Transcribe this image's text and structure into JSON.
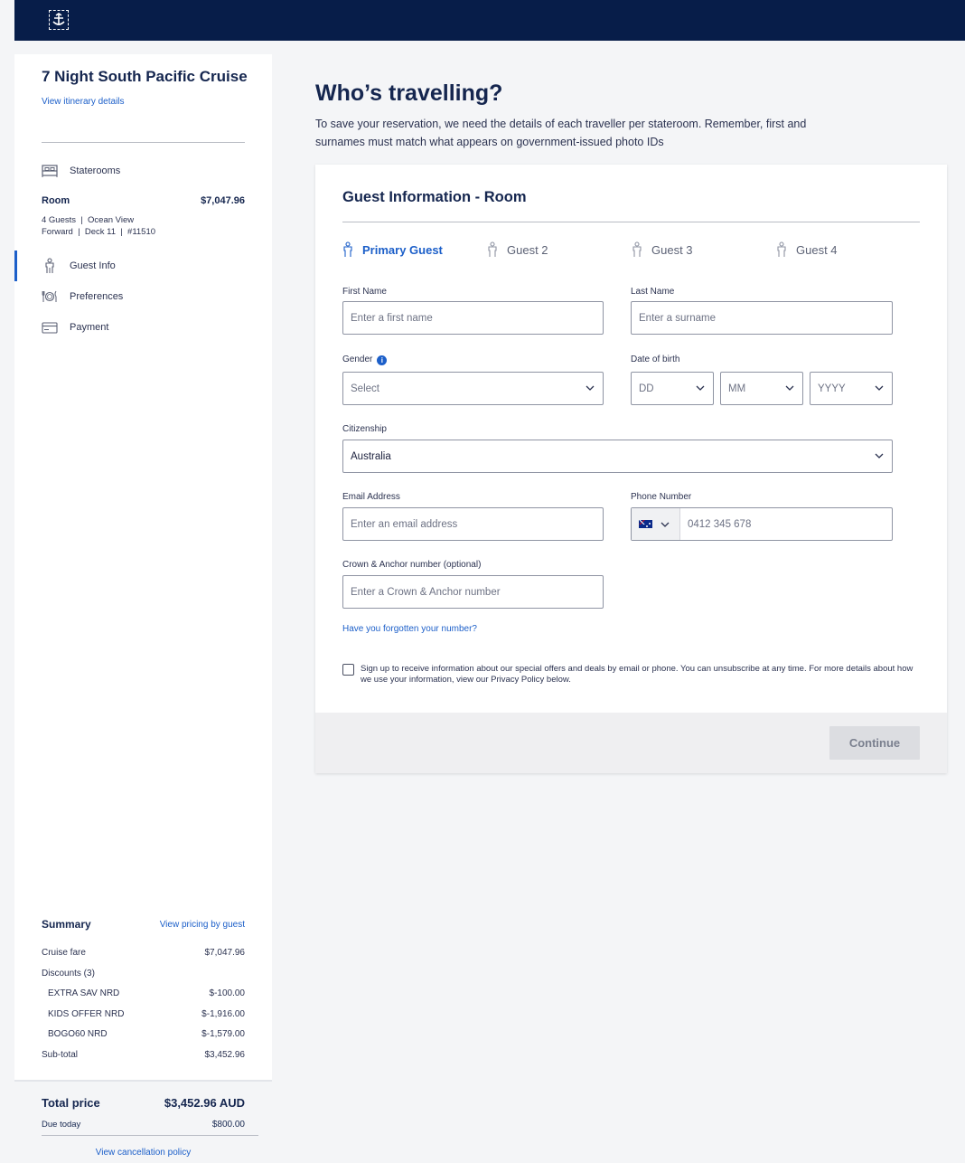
{
  "header": {
    "logo_icon": "crown-anchor-logo-icon"
  },
  "sidebar": {
    "cruise_title": "7 Night South Pacific Cruise",
    "itinerary_link": "View itinerary details",
    "steps": [
      {
        "label": "Staterooms",
        "icon": "bed-icon"
      },
      {
        "label": "Guest Info",
        "icon": "person-icon"
      },
      {
        "label": "Preferences",
        "icon": "dining-icon"
      },
      {
        "label": "Payment",
        "icon": "credit-card-icon"
      }
    ],
    "room": {
      "label": "Room",
      "price": "$7,047.96",
      "line1": "4 Guests  |  Ocean View",
      "line2": "Forward  |  Deck 11  |  #11510"
    },
    "summary": {
      "title": "Summary",
      "pricing_link": "View pricing by guest",
      "rows": [
        {
          "label": "Cruise fare",
          "value": "$7,047.96"
        },
        {
          "label": "Discounts (3)",
          "value": ""
        },
        {
          "label": "EXTRA SAV NRD",
          "value": "$-100.00"
        },
        {
          "label": "KIDS OFFER NRD",
          "value": "$-1,916.00"
        },
        {
          "label": "BOGO60 NRD",
          "value": "$-1,579.00"
        },
        {
          "label": "Sub-total",
          "value": "$3,452.96"
        }
      ]
    },
    "total": {
      "label": "Total price",
      "value": "$3,452.96 AUD",
      "due_label": "Due today",
      "due_value": "$800.00",
      "cancel_link": "View cancellation policy"
    }
  },
  "main": {
    "title": "Who’s travelling?",
    "description": "To save your reservation, we need the details of each traveller per stateroom. Remember, first and surnames must match what appears on government-issued photo IDs",
    "card": {
      "title": "Guest Information - Room",
      "tabs": [
        {
          "label": "Primary Guest",
          "active": true
        },
        {
          "label": "Guest 2",
          "active": false
        },
        {
          "label": "Guest 3",
          "active": false
        },
        {
          "label": "Guest 4",
          "active": false
        }
      ],
      "fields": {
        "first_name": {
          "label": "First Name",
          "placeholder": "Enter a first name"
        },
        "last_name": {
          "label": "Last Name",
          "placeholder": "Enter a surname"
        },
        "gender": {
          "label": "Gender",
          "placeholder": "Select"
        },
        "dob": {
          "label": "Date of birth",
          "dd": "DD",
          "mm": "MM",
          "yyyy": "YYYY"
        },
        "citizenship": {
          "label": "Citizenship",
          "value": "Australia"
        },
        "email": {
          "label": "Email Address",
          "placeholder": "Enter an email address"
        },
        "phone": {
          "label": "Phone Number",
          "placeholder": "0412 345 678",
          "flag_icon": "australia-flag-icon"
        },
        "crown_anchor": {
          "label": "Crown & Anchor number (optional)",
          "placeholder": "Enter a Crown & Anchor number"
        }
      },
      "forgot_link": "Have you forgotten your number?",
      "consent_text": "Sign up to receive information about our special offers and deals by email or phone. You can unsubscribe at any time. For more details about how we use your information, view our Privacy Policy below.",
      "continue_label": "Continue"
    }
  },
  "colors": {
    "navy": "#071d49",
    "link_blue": "#1c5fc9",
    "text": "#15264f"
  }
}
